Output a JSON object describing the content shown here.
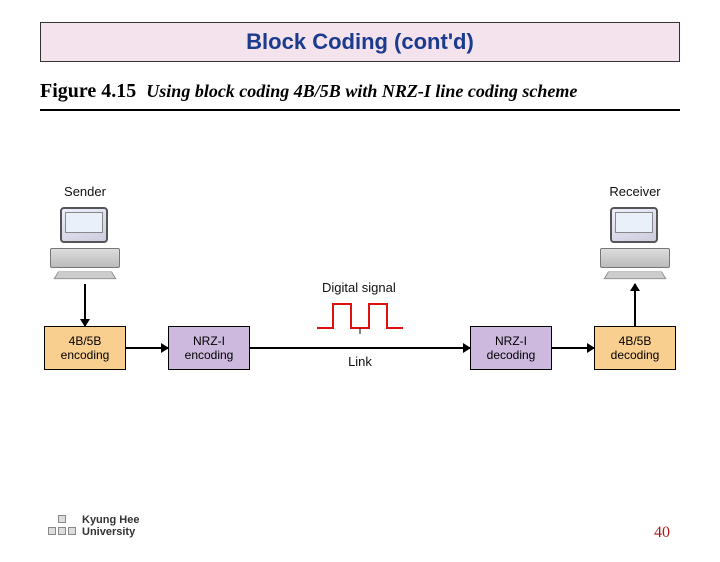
{
  "title": "Block Coding (cont'd)",
  "figure": {
    "number": "Figure 4.15",
    "caption": "Using block coding 4B/5B with NRZ-I line coding scheme"
  },
  "diagram": {
    "sender_label": "Sender",
    "receiver_label": "Receiver",
    "signal_label": "Digital signal",
    "link_label": "Link",
    "blocks": {
      "b1": {
        "line1": "4B/5B",
        "line2": "encoding"
      },
      "b2": {
        "line1": "NRZ-I",
        "line2": "encoding"
      },
      "b3": {
        "line1": "NRZ-I",
        "line2": "decoding"
      },
      "b4": {
        "line1": "4B/5B",
        "line2": "decoding"
      }
    }
  },
  "footer": {
    "line1": "Kyung Hee",
    "line2": "University"
  },
  "page_number": "40"
}
